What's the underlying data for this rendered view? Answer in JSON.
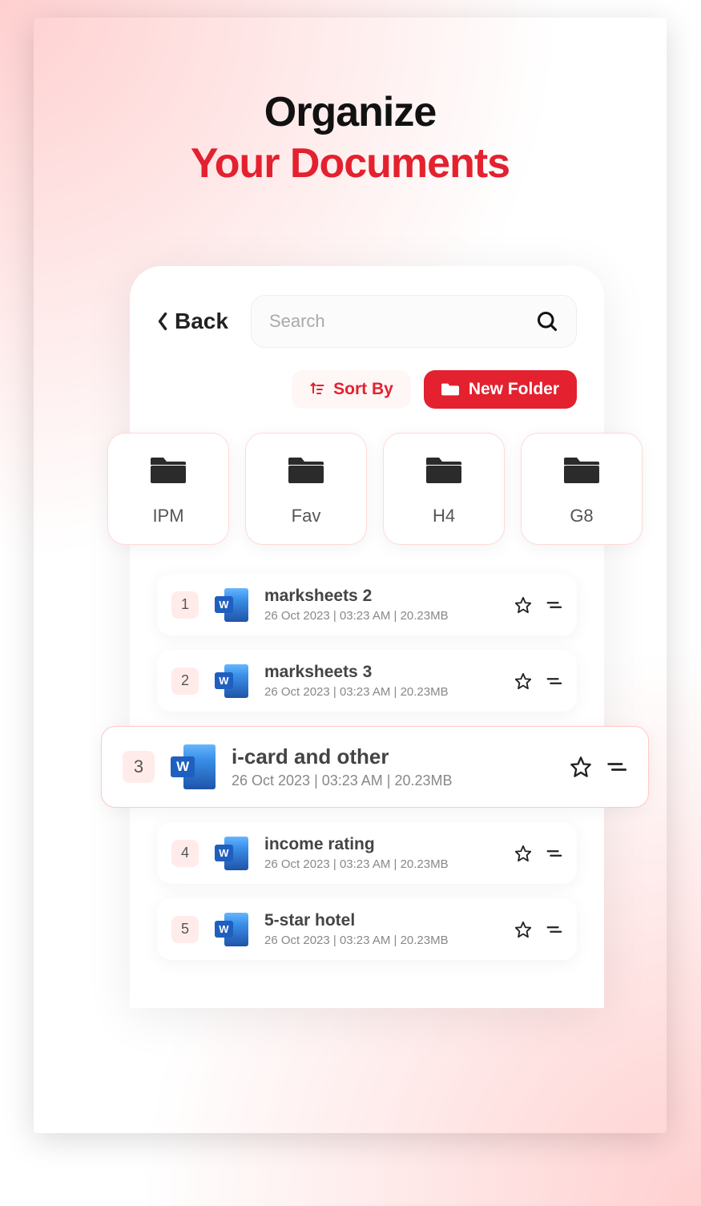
{
  "hero": {
    "line1": "Organize",
    "line2": "Your Documents"
  },
  "back_label": "Back",
  "search": {
    "placeholder": "Search"
  },
  "actions": {
    "sort_label": "Sort By",
    "new_folder_label": "New Folder"
  },
  "folders": [
    {
      "label": "IPM"
    },
    {
      "label": "Fav"
    },
    {
      "label": "H4"
    },
    {
      "label": "G8"
    }
  ],
  "docs": [
    {
      "num": "1",
      "title": "marksheets 2",
      "meta": "26 Oct 2023 | 03:23 AM | 20.23MB",
      "highlight": false
    },
    {
      "num": "2",
      "title": "marksheets 3",
      "meta": "26 Oct 2023 | 03:23 AM | 20.23MB",
      "highlight": false
    },
    {
      "num": "3",
      "title": "i-card and other",
      "meta": "26 Oct 2023 | 03:23 AM | 20.23MB",
      "highlight": true
    },
    {
      "num": "4",
      "title": "income rating",
      "meta": "26 Oct 2023 | 03:23 AM | 20.23MB",
      "highlight": false
    },
    {
      "num": "5",
      "title": "5-star hotel",
      "meta": "26 Oct 2023 | 03:23 AM | 20.23MB",
      "highlight": false
    }
  ],
  "word_badge": "W"
}
